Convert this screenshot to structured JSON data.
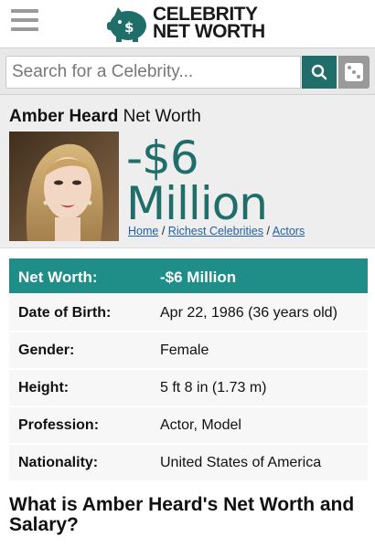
{
  "header": {
    "logo_line1": "CELEBRITY",
    "logo_line2": "NET WORTH",
    "menu_icon": "hamburger-menu-icon",
    "logo_icon": "piggy-bank-icon"
  },
  "search": {
    "placeholder": "Search for a Celebrity...",
    "button_icon": "search-icon",
    "random_icon": "dice-icon"
  },
  "profile": {
    "name": "Amber Heard",
    "title_suffix": "Net Worth",
    "net_worth_line1": "-$6",
    "net_worth_line2": "Million",
    "breadcrumb": {
      "home": "Home",
      "sep1": "/",
      "category": "Richest Celebrities",
      "sep2": "/",
      "subcategory": "Actors"
    }
  },
  "info_table": {
    "rows": [
      {
        "label": "Net Worth:",
        "value": "-$6 Million"
      },
      {
        "label": "Date of Birth:",
        "value": "Apr 22, 1986 (36 years old)"
      },
      {
        "label": "Gender:",
        "value": "Female"
      },
      {
        "label": "Height:",
        "value": "5 ft 8 in (1.73 m)"
      },
      {
        "label": "Profession:",
        "value": "Actor, Model"
      },
      {
        "label": "Nationality:",
        "value": "United States of America"
      }
    ]
  },
  "article": {
    "title": "What is Amber Heard's Net Worth and Salary?"
  },
  "colors": {
    "brand_teal": "#1f6e6a",
    "table_header": "#1f8e88",
    "link": "#1f5fa8"
  }
}
